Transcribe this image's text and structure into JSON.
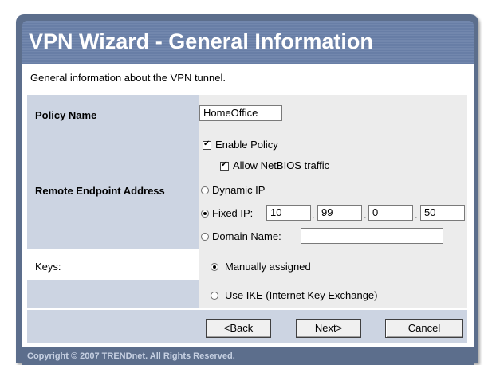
{
  "title": "VPN Wizard - General Information",
  "intro": "General information about the VPN tunnel.",
  "policy_name": {
    "label": "Policy Name",
    "value": "HomeOffice"
  },
  "enable_policy": {
    "label": "Enable Policy",
    "checked": true
  },
  "allow_netbios": {
    "label": "Allow NetBIOS traffic",
    "checked": true
  },
  "remote_endpoint": {
    "label": "Remote Endpoint Address",
    "dynamic_ip_label": "Dynamic IP",
    "fixed_ip_label": "Fixed IP:",
    "fixed_ip_selected": true,
    "ip_octets": [
      "10",
      "99",
      "0",
      "50"
    ],
    "ip_separator": ".",
    "domain_name_label": "Domain Name:",
    "domain_name_value": ""
  },
  "keys": {
    "label": "Keys:",
    "manual_label": "Manually assigned",
    "manual_selected": true,
    "ike_label": "Use IKE (Internet Key Exchange)"
  },
  "buttons": {
    "back": "<Back",
    "next": "Next>",
    "cancel": "Cancel"
  },
  "copyright": "Copyright © 2007 TRENDnet. All Rights Reserved.",
  "colors": {
    "frame": "#5c6e8c",
    "title_bar": "#7287ad",
    "label_column": "#ccd4e2",
    "field_column": "#ececec",
    "title_text": "#ffffff"
  }
}
